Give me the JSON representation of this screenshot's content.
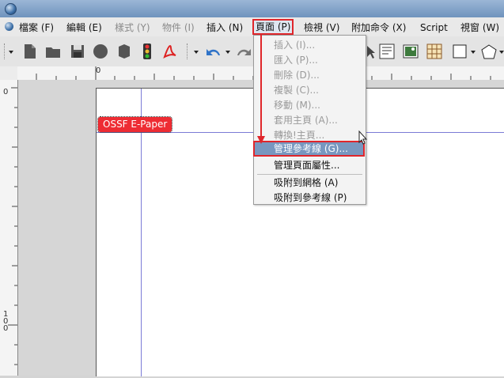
{
  "menubar": {
    "file": "檔案 (F)",
    "edit": "編輯 (E)",
    "style": "樣式 (Y)",
    "item": "物件 (I)",
    "insert": "插入 (N)",
    "page": "頁面 (P)",
    "view": "檢視 (V)",
    "extras": "附加命令 (X)",
    "script": "Script",
    "windows": "視窗 (W)"
  },
  "canvas": {
    "text_frame_label": "OSSF E-Paper",
    "ruler_top_zero": "0",
    "ruler_left_zero": "0",
    "ruler_left_100": "100"
  },
  "page_menu": {
    "items": [
      {
        "label": "插入 (I)...",
        "enabled": false
      },
      {
        "label": "匯入 (P)...",
        "enabled": false
      },
      {
        "label": "刪除 (D)...",
        "enabled": false
      },
      {
        "label": "複製 (C)...",
        "enabled": false
      },
      {
        "label": "移動 (M)...",
        "enabled": false
      },
      {
        "label": "套用主頁 (A)...",
        "enabled": false
      },
      {
        "label": "轉換!主頁...",
        "enabled": false
      }
    ],
    "highlighted": "管理參考線 (G)...",
    "properties": "管理頁面屬性...",
    "snap_grid": "吸附到網格 (A)",
    "snap_guides": "吸附到參考線 (P)"
  },
  "colors": {
    "highlight_red": "#e0262b",
    "selection_blue": "#7897bf",
    "guide_line": "#7b7bd6",
    "frame_red": "#ee2c33"
  }
}
